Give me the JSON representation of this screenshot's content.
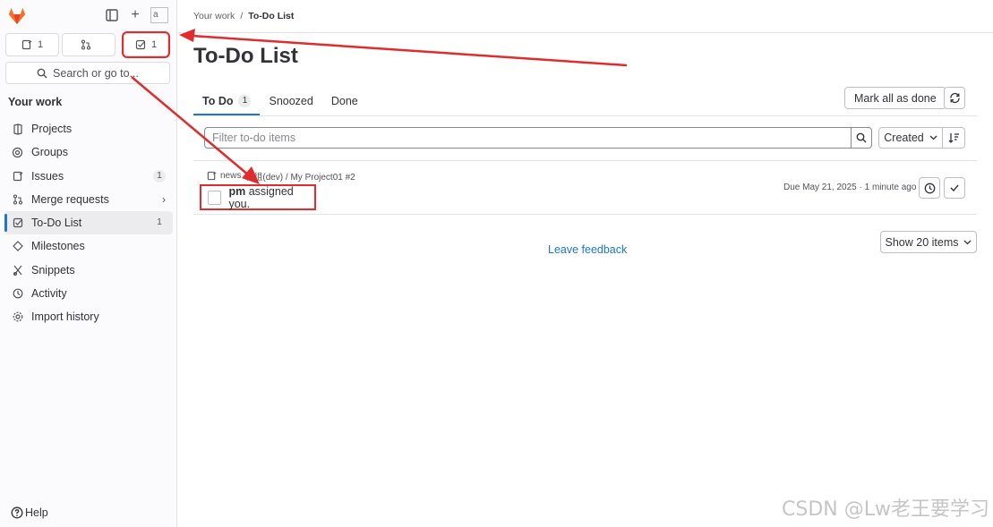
{
  "sidebar": {
    "counters": [
      {
        "icon": "issues-icon",
        "count": "1"
      },
      {
        "icon": "merge-request-icon",
        "count": ""
      },
      {
        "icon": "todo-icon",
        "count": "1"
      }
    ],
    "search_label": "Search or go to...",
    "section_title": "Your work",
    "items": [
      {
        "label": "Projects",
        "icon": "project-icon",
        "badge": ""
      },
      {
        "label": "Groups",
        "icon": "group-icon",
        "badge": ""
      },
      {
        "label": "Issues",
        "icon": "issues-icon",
        "badge": "1"
      },
      {
        "label": "Merge requests",
        "icon": "merge-request-icon",
        "badge": ""
      },
      {
        "label": "To-Do List",
        "icon": "todo-icon",
        "badge": "1"
      },
      {
        "label": "Milestones",
        "icon": "milestone-icon",
        "badge": ""
      },
      {
        "label": "Snippets",
        "icon": "snippet-icon",
        "badge": ""
      },
      {
        "label": "Activity",
        "icon": "history-icon",
        "badge": ""
      },
      {
        "label": "Import history",
        "icon": "import-icon",
        "badge": ""
      }
    ],
    "help_label": "Help",
    "avatar_alt": "a"
  },
  "breadcrumb": {
    "parent": "Your work",
    "separator": "/",
    "current": "To-Do List"
  },
  "page": {
    "title": "To-Do List"
  },
  "tabs": [
    {
      "label": "To Do",
      "count": "1"
    },
    {
      "label": "Snoozed",
      "count": ""
    },
    {
      "label": "Done",
      "count": ""
    }
  ],
  "actions": {
    "mark_all": "Mark all as done"
  },
  "filter": {
    "placeholder": "Filter to-do items",
    "sort_label": "Created"
  },
  "todo": {
    "path_prefix": "news",
    "path_rest": "发组(dev) / My Project01 #2",
    "author": "pm",
    "action": "assigned you.",
    "meta": "Due May 21, 2025 · 1 minute ago"
  },
  "footer": {
    "feedback": "Leave feedback",
    "page_size": "Show 20 items"
  },
  "watermark": "CSDN @Lw老王要学习",
  "colors": {
    "accent": "#1f75cb",
    "highlight": "#e02c2c",
    "sidebar_bg": "#fbfafd"
  }
}
